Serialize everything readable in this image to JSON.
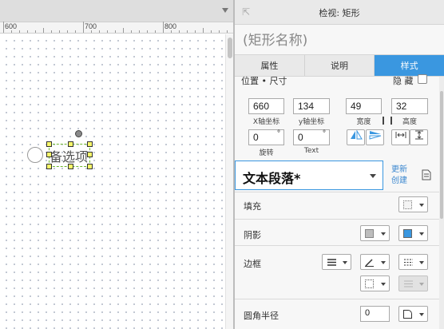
{
  "ruler": {
    "labels": [
      "600",
      "700",
      "800"
    ]
  },
  "canvas": {
    "widget_label": "备选项"
  },
  "inspector": {
    "title": "检视: 矩形",
    "shape_name": "(矩形名称)",
    "tabs": [
      {
        "label": "属性",
        "active": false
      },
      {
        "label": "说明",
        "active": false
      },
      {
        "label": "样式",
        "active": true
      }
    ],
    "position_size_label": "位置 • 尺寸",
    "hidden_label": "隐 藏",
    "x_value": "660",
    "x_caption": "X轴坐标",
    "y_value": "134",
    "y_caption": "y轴坐标",
    "width_value": "49",
    "width_caption": "宽度",
    "height_value": "32",
    "height_caption": "高度",
    "rotation_value": "0",
    "rotation_caption": "旋转",
    "text_rotation_value": "0",
    "text_rotation_caption": "Text",
    "degree_symbol": "°",
    "style_select_value": "文本段落*",
    "update_link": "更新",
    "create_link": "创建",
    "fill_label": "填充",
    "shadow_label": "阴影",
    "border_label": "边框",
    "radius_label": "圆角半径",
    "radius_value": "0"
  },
  "colors": {
    "accent": "#3a97e0",
    "selection": "#6cb82c",
    "handle": "#f7f76a"
  }
}
